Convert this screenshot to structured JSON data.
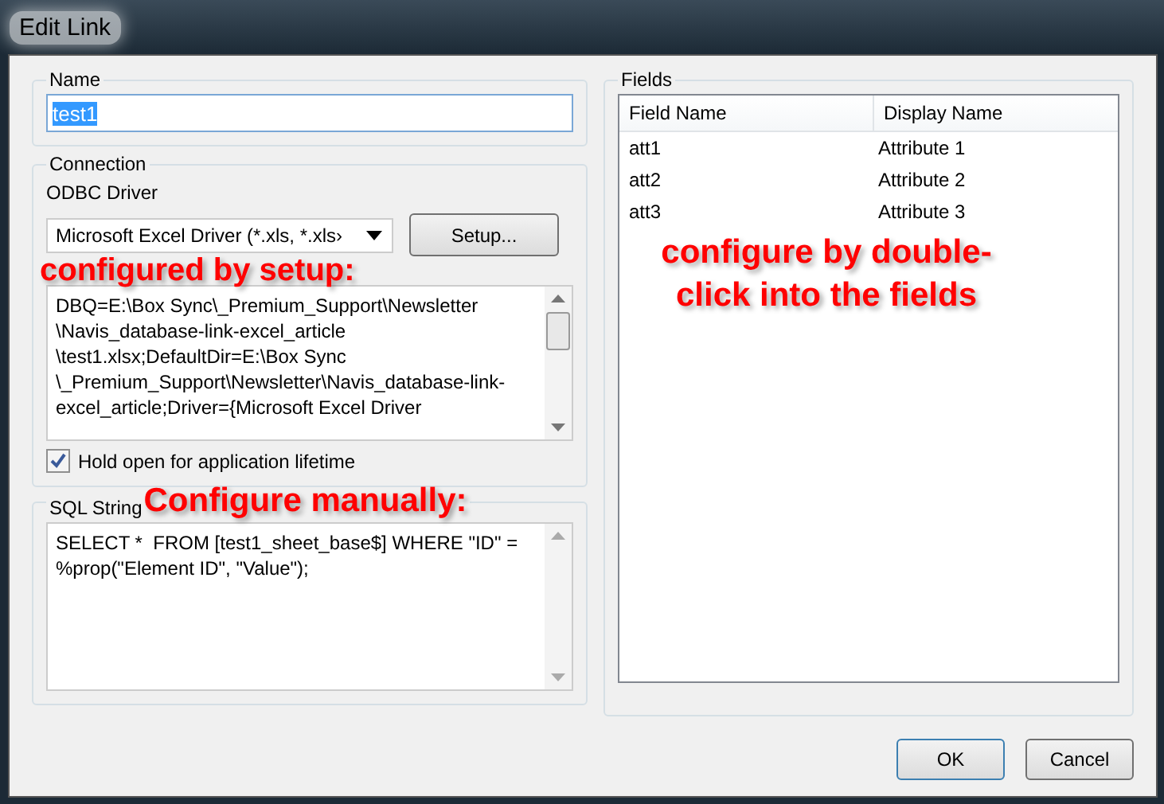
{
  "window": {
    "title": "Edit Link"
  },
  "name_group": {
    "label": "Name",
    "value": "test1",
    "selected": true
  },
  "connection": {
    "label": "Connection",
    "driver_label": "ODBC Driver",
    "driver_value": "Microsoft Excel Driver (*.xls, *.xls›",
    "setup_button": "Setup...",
    "annotation": "configured by setup:",
    "connection_string": "DBQ=E:\\Box Sync\\_Premium_Support\\Newsletter \\Navis_database-link-excel_article \\test1.xlsx;DefaultDir=E:\\Box Sync \\_Premium_Support\\Newsletter\\Navis_database-link-excel_article;Driver={Microsoft Excel Driver",
    "hold_open": {
      "label": "Hold open for application lifetime",
      "checked": true
    }
  },
  "sql": {
    "label": "SQL String",
    "annotation": "Configure manually:",
    "value": "SELECT *  FROM [test1_sheet_base$] WHERE \"ID\" = %prop(\"Element ID\", \"Value\");"
  },
  "fields": {
    "label": "Fields",
    "columns": [
      "Field Name",
      "Display Name"
    ],
    "rows": [
      [
        "att1",
        "Attribute 1"
      ],
      [
        "att2",
        "Attribute 2"
      ],
      [
        "att3",
        "Attribute 3"
      ]
    ],
    "annotation": "configure by double-click into the fields"
  },
  "buttons": [
    "OK",
    "Cancel"
  ]
}
